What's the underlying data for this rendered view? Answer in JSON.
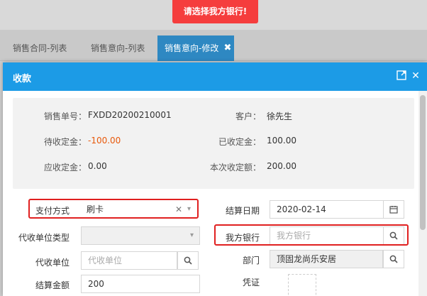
{
  "toast": {
    "message": "请选择我方银行!"
  },
  "tabs": [
    {
      "label": "销售合同-列表"
    },
    {
      "label": "销售意向-列表"
    },
    {
      "label": "销售意向-修改"
    }
  ],
  "modal": {
    "title": "收款",
    "icons": {
      "maximize": "maximize-icon",
      "close": "close-icon"
    },
    "info": {
      "order_no_label": "销售单号：",
      "order_no": "FXDD20200210001",
      "customer_label": "客户：",
      "customer": "徐先生",
      "pending_deposit_label": "待收定金：",
      "pending_deposit": "-100.00",
      "received_deposit_label": "已收定金：",
      "received_deposit": "100.00",
      "due_deposit_label": "应收定金：",
      "due_deposit": "0.00",
      "current_deposit_label": "本次收定额：",
      "current_deposit": "200.00"
    },
    "form": {
      "payment_method_label": "支付方式",
      "payment_method_value": "刷卡",
      "settle_date_label": "结算日期",
      "settle_date_value": "2020-02-14",
      "agent_type_label": "代收单位类型",
      "agent_type_value": "",
      "our_bank_label": "我方银行",
      "our_bank_placeholder": "我方银行",
      "agent_unit_label": "代收单位",
      "agent_unit_placeholder": "代收单位",
      "department_label": "部门",
      "department_value": "顶固龙尚乐安居",
      "settle_amount_label": "结算金额",
      "settle_amount_value": "200",
      "voucher_label": "凭证"
    }
  },
  "colors": {
    "header": "#1c9be6",
    "toast": "#f53d3d",
    "highlight": "#e02020",
    "negative": "#e8590c"
  }
}
